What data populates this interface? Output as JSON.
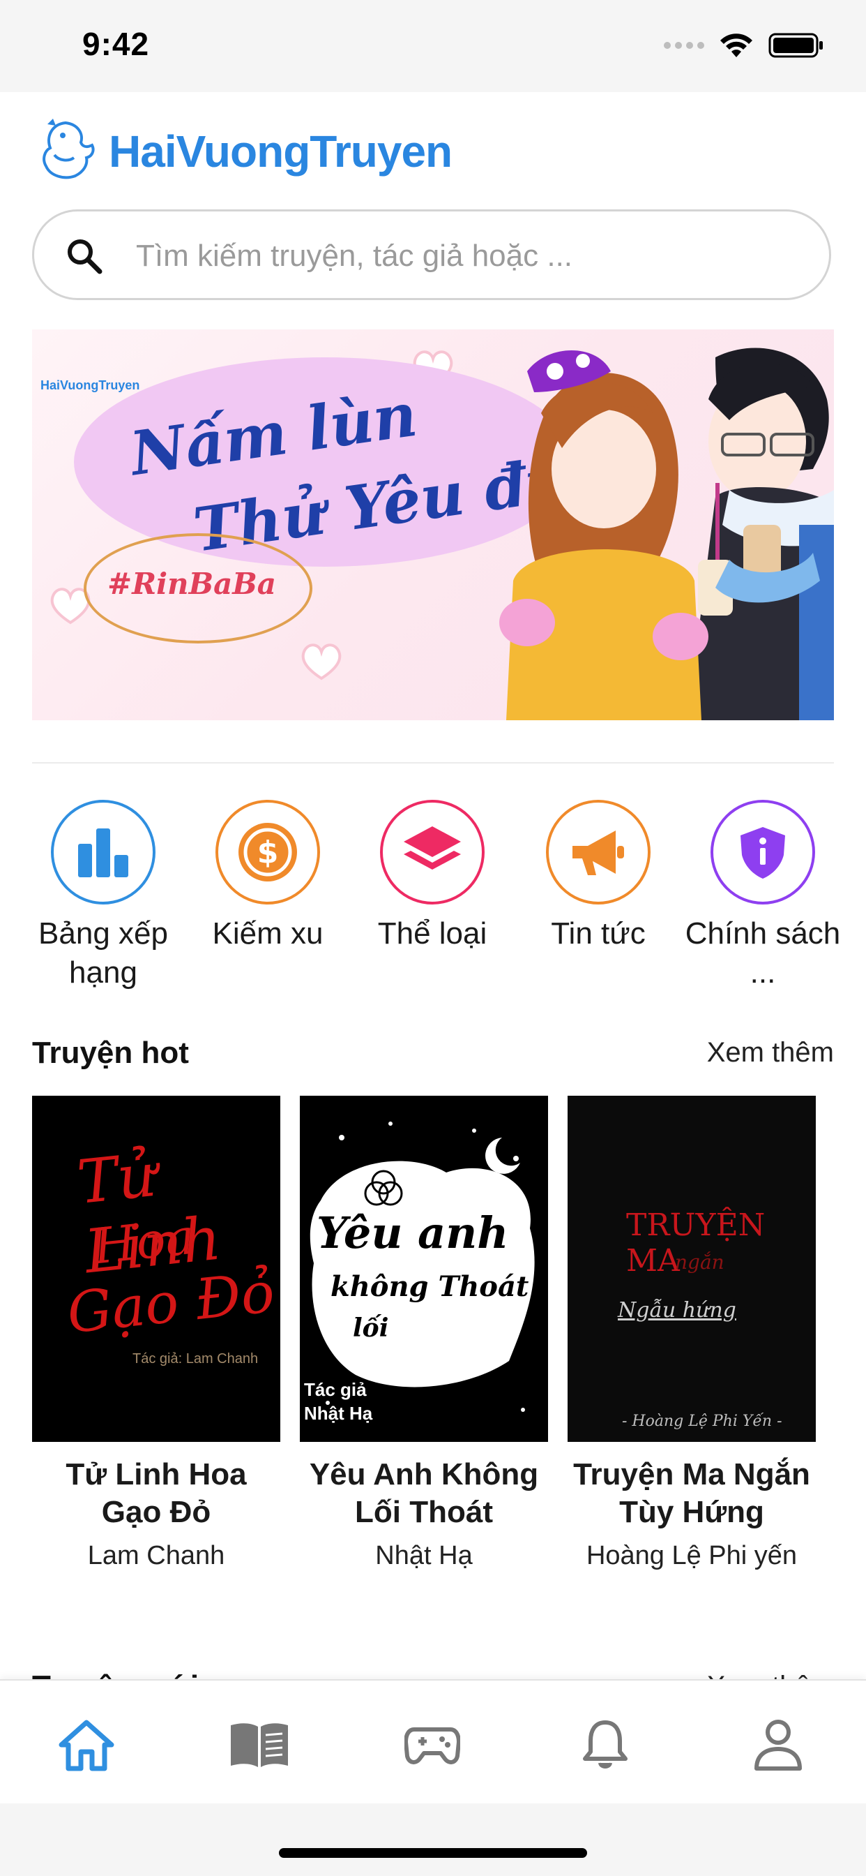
{
  "status_bar": {
    "time": "9:42"
  },
  "header": {
    "app_title": "HaiVuongTruyen"
  },
  "search": {
    "placeholder": "Tìm kiếm truyện, tác giả hoặc ..."
  },
  "banner": {
    "logo_text": "HaiVuongTruyen",
    "title_line1": "Nấm lùn",
    "title_line2": "Thử Yêu đi!",
    "tag": "#RinBaBa"
  },
  "quick_menu": [
    {
      "label": "Bảng xếp hạng",
      "icon": "bar-chart-icon",
      "color": "#2f8fe0"
    },
    {
      "label": "Kiếm xu",
      "icon": "coin-dollar-icon",
      "color": "#f08a2a"
    },
    {
      "label": "Thể loại",
      "icon": "layers-icon",
      "color": "#ee2a63"
    },
    {
      "label": "Tin tức",
      "icon": "megaphone-icon",
      "color": "#f08a2a"
    },
    {
      "label": "Chính sách ...",
      "icon": "shield-icon",
      "color": "#8e3ff0"
    }
  ],
  "hot_section": {
    "title": "Truyện hot",
    "more_label": "Xem thêm",
    "books": [
      {
        "title": "Tử Linh Hoa Gạo Đỏ",
        "author": "Lam Chanh",
        "cover_text_1": "Tử Linh",
        "cover_text_2": "Hoa",
        "cover_text_3": "Gạo Đỏ",
        "cover_author": "Tác giả: Lam Chanh"
      },
      {
        "title": "Yêu Anh Không Lối Thoát",
        "author": "Nhật Hạ",
        "cover_text_1": "Yêu anh",
        "cover_text_2": "không Thoát",
        "cover_text_3": "lối",
        "cover_author": "Tác giả Nhật Hạ"
      },
      {
        "title": "Truyện Ma Ngắn Tùy Hứng",
        "author": "Hoàng Lệ Phi yến",
        "cover_text_1": "TRUYỆN MA",
        "cover_text_2": "ngắn",
        "cover_text_3": "Ngẫu hứng",
        "cover_author": "- Hoàng Lệ Phi Yến -"
      }
    ]
  },
  "next_section": {
    "title": "Truyện mới",
    "more_label": "Xem thêm"
  },
  "tab_bar": {
    "active_color": "#2f8fe0",
    "inactive_color": "#777777",
    "tabs": [
      "home-icon",
      "book-icon",
      "gamepad-icon",
      "bell-icon",
      "user-icon"
    ]
  }
}
